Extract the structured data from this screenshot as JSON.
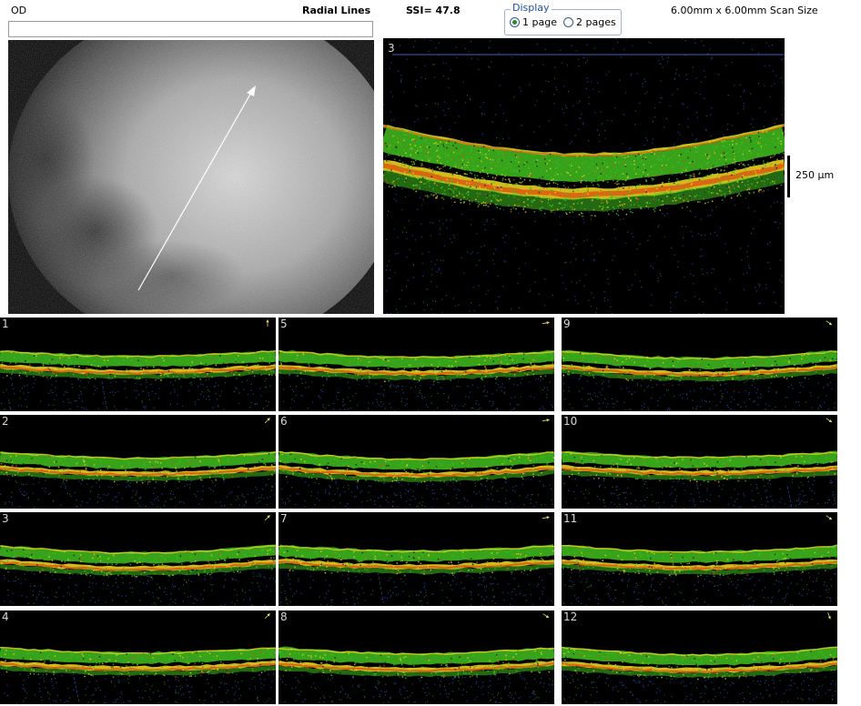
{
  "header": {
    "eye": "OD",
    "scan_type": "Radial Lines",
    "ssi": "SSI= 47.8",
    "scan_size": "6.00mm x 6.00mm Scan Size"
  },
  "display": {
    "legend": "Display",
    "options": [
      "1 page",
      "2 pages"
    ],
    "selected": "1 page"
  },
  "main_scan": {
    "number": "3",
    "scale_label": "250 µm"
  },
  "thumbnails": [
    {
      "number": "1",
      "arrow": "up-arrow-icon"
    },
    {
      "number": "2",
      "arrow": "up-right-arrow-icon"
    },
    {
      "number": "3",
      "arrow": "up-right-arrow-icon"
    },
    {
      "number": "4",
      "arrow": "up-right-arrow-icon"
    },
    {
      "number": "5",
      "arrow": "right-arrow-icon"
    },
    {
      "number": "6",
      "arrow": "right-arrow-icon"
    },
    {
      "number": "7",
      "arrow": "right-arrow-icon"
    },
    {
      "number": "8",
      "arrow": "down-right-arrow-icon"
    },
    {
      "number": "9",
      "arrow": "down-right-arrow-icon"
    },
    {
      "number": "10",
      "arrow": "down-right-arrow-icon"
    },
    {
      "number": "11",
      "arrow": "down-right-arrow-icon"
    },
    {
      "number": "12",
      "arrow": "down-arrow-icon"
    }
  ],
  "colors": {
    "background": "#ffffff",
    "scan_background": "#000000",
    "retina_green": "#3fbf1f",
    "retina_yellow": "#e8d020",
    "retina_red": "#e04a10",
    "noise_blue": "#3050d0",
    "arrow_yellow": "#e8e060"
  }
}
